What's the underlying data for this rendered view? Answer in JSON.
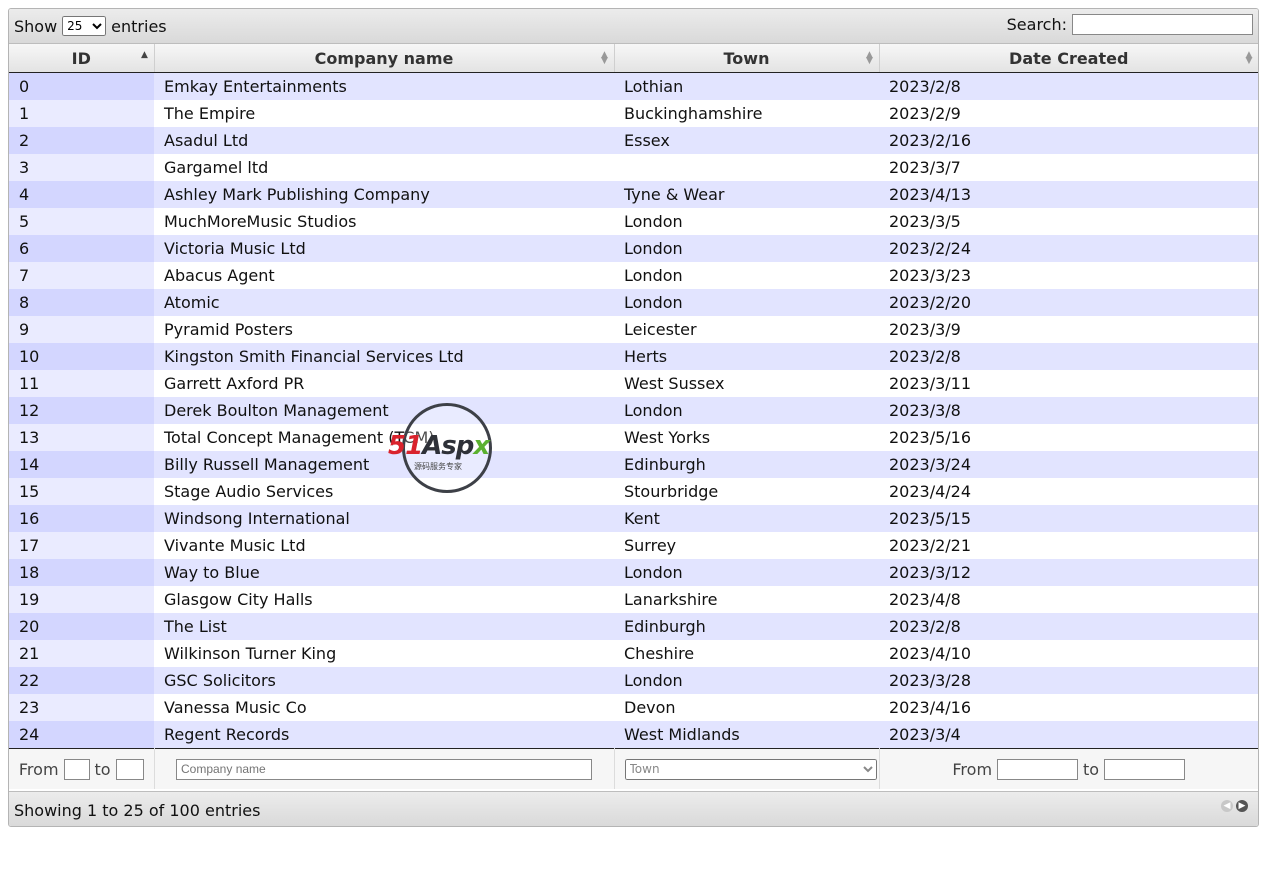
{
  "toolbar": {
    "show_label": "Show",
    "entries_label": "entries",
    "length_value": "25",
    "search_label": "Search:",
    "search_value": ""
  },
  "columns": [
    {
      "label": "ID",
      "sort": "asc"
    },
    {
      "label": "Company name",
      "sort": "both"
    },
    {
      "label": "Town",
      "sort": "both"
    },
    {
      "label": "Date Created",
      "sort": "both"
    }
  ],
  "rows": [
    [
      "0",
      "Emkay Entertainments",
      "Lothian",
      "2023/2/8"
    ],
    [
      "1",
      "The Empire",
      "Buckinghamshire",
      "2023/2/9"
    ],
    [
      "2",
      "Asadul Ltd",
      "Essex",
      "2023/2/16"
    ],
    [
      "3",
      "Gargamel ltd",
      "",
      "2023/3/7"
    ],
    [
      "4",
      "Ashley Mark Publishing Company",
      "Tyne & Wear",
      "2023/4/13"
    ],
    [
      "5",
      "MuchMoreMusic Studios",
      "London",
      "2023/3/5"
    ],
    [
      "6",
      "Victoria Music Ltd",
      "London",
      "2023/2/24"
    ],
    [
      "7",
      "Abacus Agent",
      "London",
      "2023/3/23"
    ],
    [
      "8",
      "Atomic",
      "London",
      "2023/2/20"
    ],
    [
      "9",
      "Pyramid Posters",
      "Leicester",
      "2023/3/9"
    ],
    [
      "10",
      "Kingston Smith Financial Services Ltd",
      "Herts",
      "2023/2/8"
    ],
    [
      "11",
      "Garrett Axford PR",
      "West Sussex",
      "2023/3/11"
    ],
    [
      "12",
      "Derek Boulton Management",
      "London",
      "2023/3/8"
    ],
    [
      "13",
      "Total Concept Management (TCM)",
      "West Yorks",
      "2023/5/16"
    ],
    [
      "14",
      "Billy Russell Management",
      "Edinburgh",
      "2023/3/24"
    ],
    [
      "15",
      "Stage Audio Services",
      "Stourbridge",
      "2023/4/24"
    ],
    [
      "16",
      "Windsong International",
      "Kent",
      "2023/5/15"
    ],
    [
      "17",
      "Vivante Music Ltd",
      "Surrey",
      "2023/2/21"
    ],
    [
      "18",
      "Way to Blue",
      "London",
      "2023/3/12"
    ],
    [
      "19",
      "Glasgow City Halls",
      "Lanarkshire",
      "2023/4/8"
    ],
    [
      "20",
      "The List",
      "Edinburgh",
      "2023/2/8"
    ],
    [
      "21",
      "Wilkinson Turner King",
      "Cheshire",
      "2023/4/10"
    ],
    [
      "22",
      "GSC Solicitors",
      "London",
      "2023/3/28"
    ],
    [
      "23",
      "Vanessa Music Co",
      "Devon",
      "2023/4/16"
    ],
    [
      "24",
      "Regent Records",
      "West Midlands",
      "2023/3/4"
    ]
  ],
  "filters": {
    "id_from_label": "From",
    "id_to_label": "to",
    "company_placeholder": "Company name",
    "town_placeholder": "Town",
    "date_from_label": "From",
    "date_to_label": "to"
  },
  "info": {
    "text": "Showing 1 to 25 of 100 entries"
  },
  "watermark": {
    "brand_a": "51",
    "brand_b": "Asp",
    "brand_c": "x",
    "subtitle": "源码服务专家"
  },
  "colors": {
    "row_odd": "#e2e4ff",
    "row_odd_sorted": "#d3d6ff",
    "row_even_sorted": "#eaebff",
    "watermark_red": "#d9232d",
    "watermark_green": "#5bb12f"
  },
  "icons": {
    "sort_asc": "sort-asc-icon",
    "sort_both": "sort-both-icon",
    "pager_prev": "prev-page-icon",
    "pager_next": "next-page-icon"
  }
}
